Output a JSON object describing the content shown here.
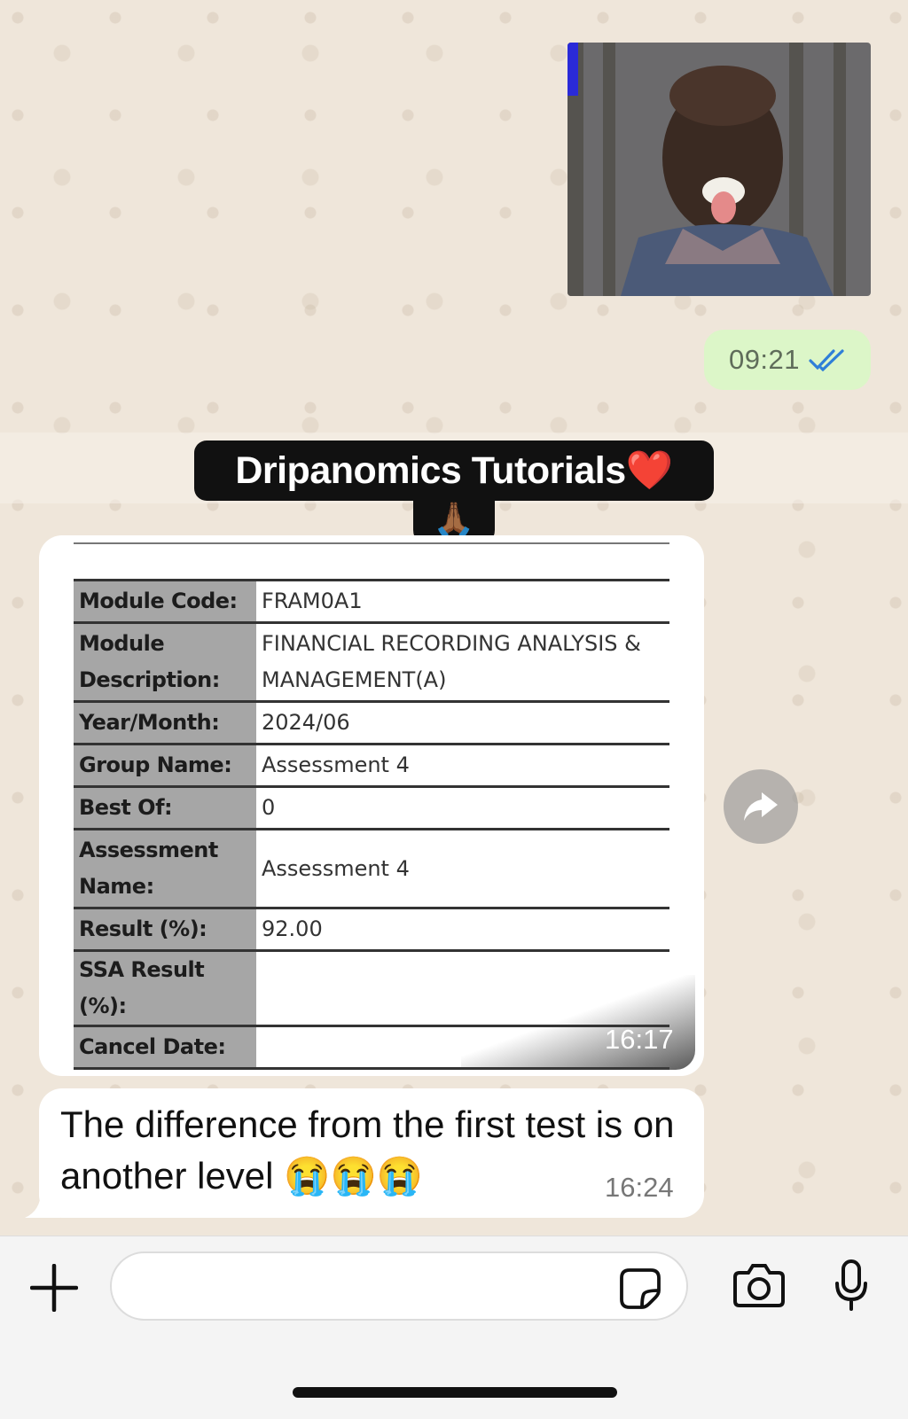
{
  "messages": {
    "photo": {
      "time": "09:21",
      "status": "read-double-check-icon",
      "tick_color": "#2f7fd8"
    },
    "story_banner": {
      "title": "Dripanomics Tutorials",
      "title_emoji": "❤️",
      "tab_emoji": "🙏🏾"
    },
    "screenshot": {
      "time": "16:17",
      "rows": [
        {
          "label": "Module Code:",
          "value": "FRAM0A1"
        },
        {
          "label": "Module Description:",
          "value": "FINANCIAL RECORDING ANALYSIS & MANAGEMENT(A)"
        },
        {
          "label": "Year/Month:",
          "value": "2024/06"
        },
        {
          "label": "Group Name:",
          "value": "Assessment 4"
        },
        {
          "label": "Best Of:",
          "value": "0"
        },
        {
          "label": "Assessment Name:",
          "value": "Assessment 4"
        },
        {
          "label": "Result (%):",
          "value": "92.00"
        },
        {
          "label": "SSA Result (%):",
          "value": ""
        },
        {
          "label": "Cancel Date:",
          "value": ""
        }
      ]
    },
    "text": {
      "body": "The difference from the first test is on another level 😭😭😭",
      "time": "16:24"
    }
  },
  "composer": {
    "placeholder": ""
  },
  "icons": {
    "add": "plus-icon",
    "sticker": "sticker-icon",
    "camera": "camera-icon",
    "mic": "microphone-icon",
    "forward": "forward-arrow-icon"
  },
  "colors": {
    "outgoing_bubble": "#dcf6c8",
    "incoming_bubble": "#ffffff",
    "chat_background": "#efe6da",
    "banner": "#111111"
  }
}
